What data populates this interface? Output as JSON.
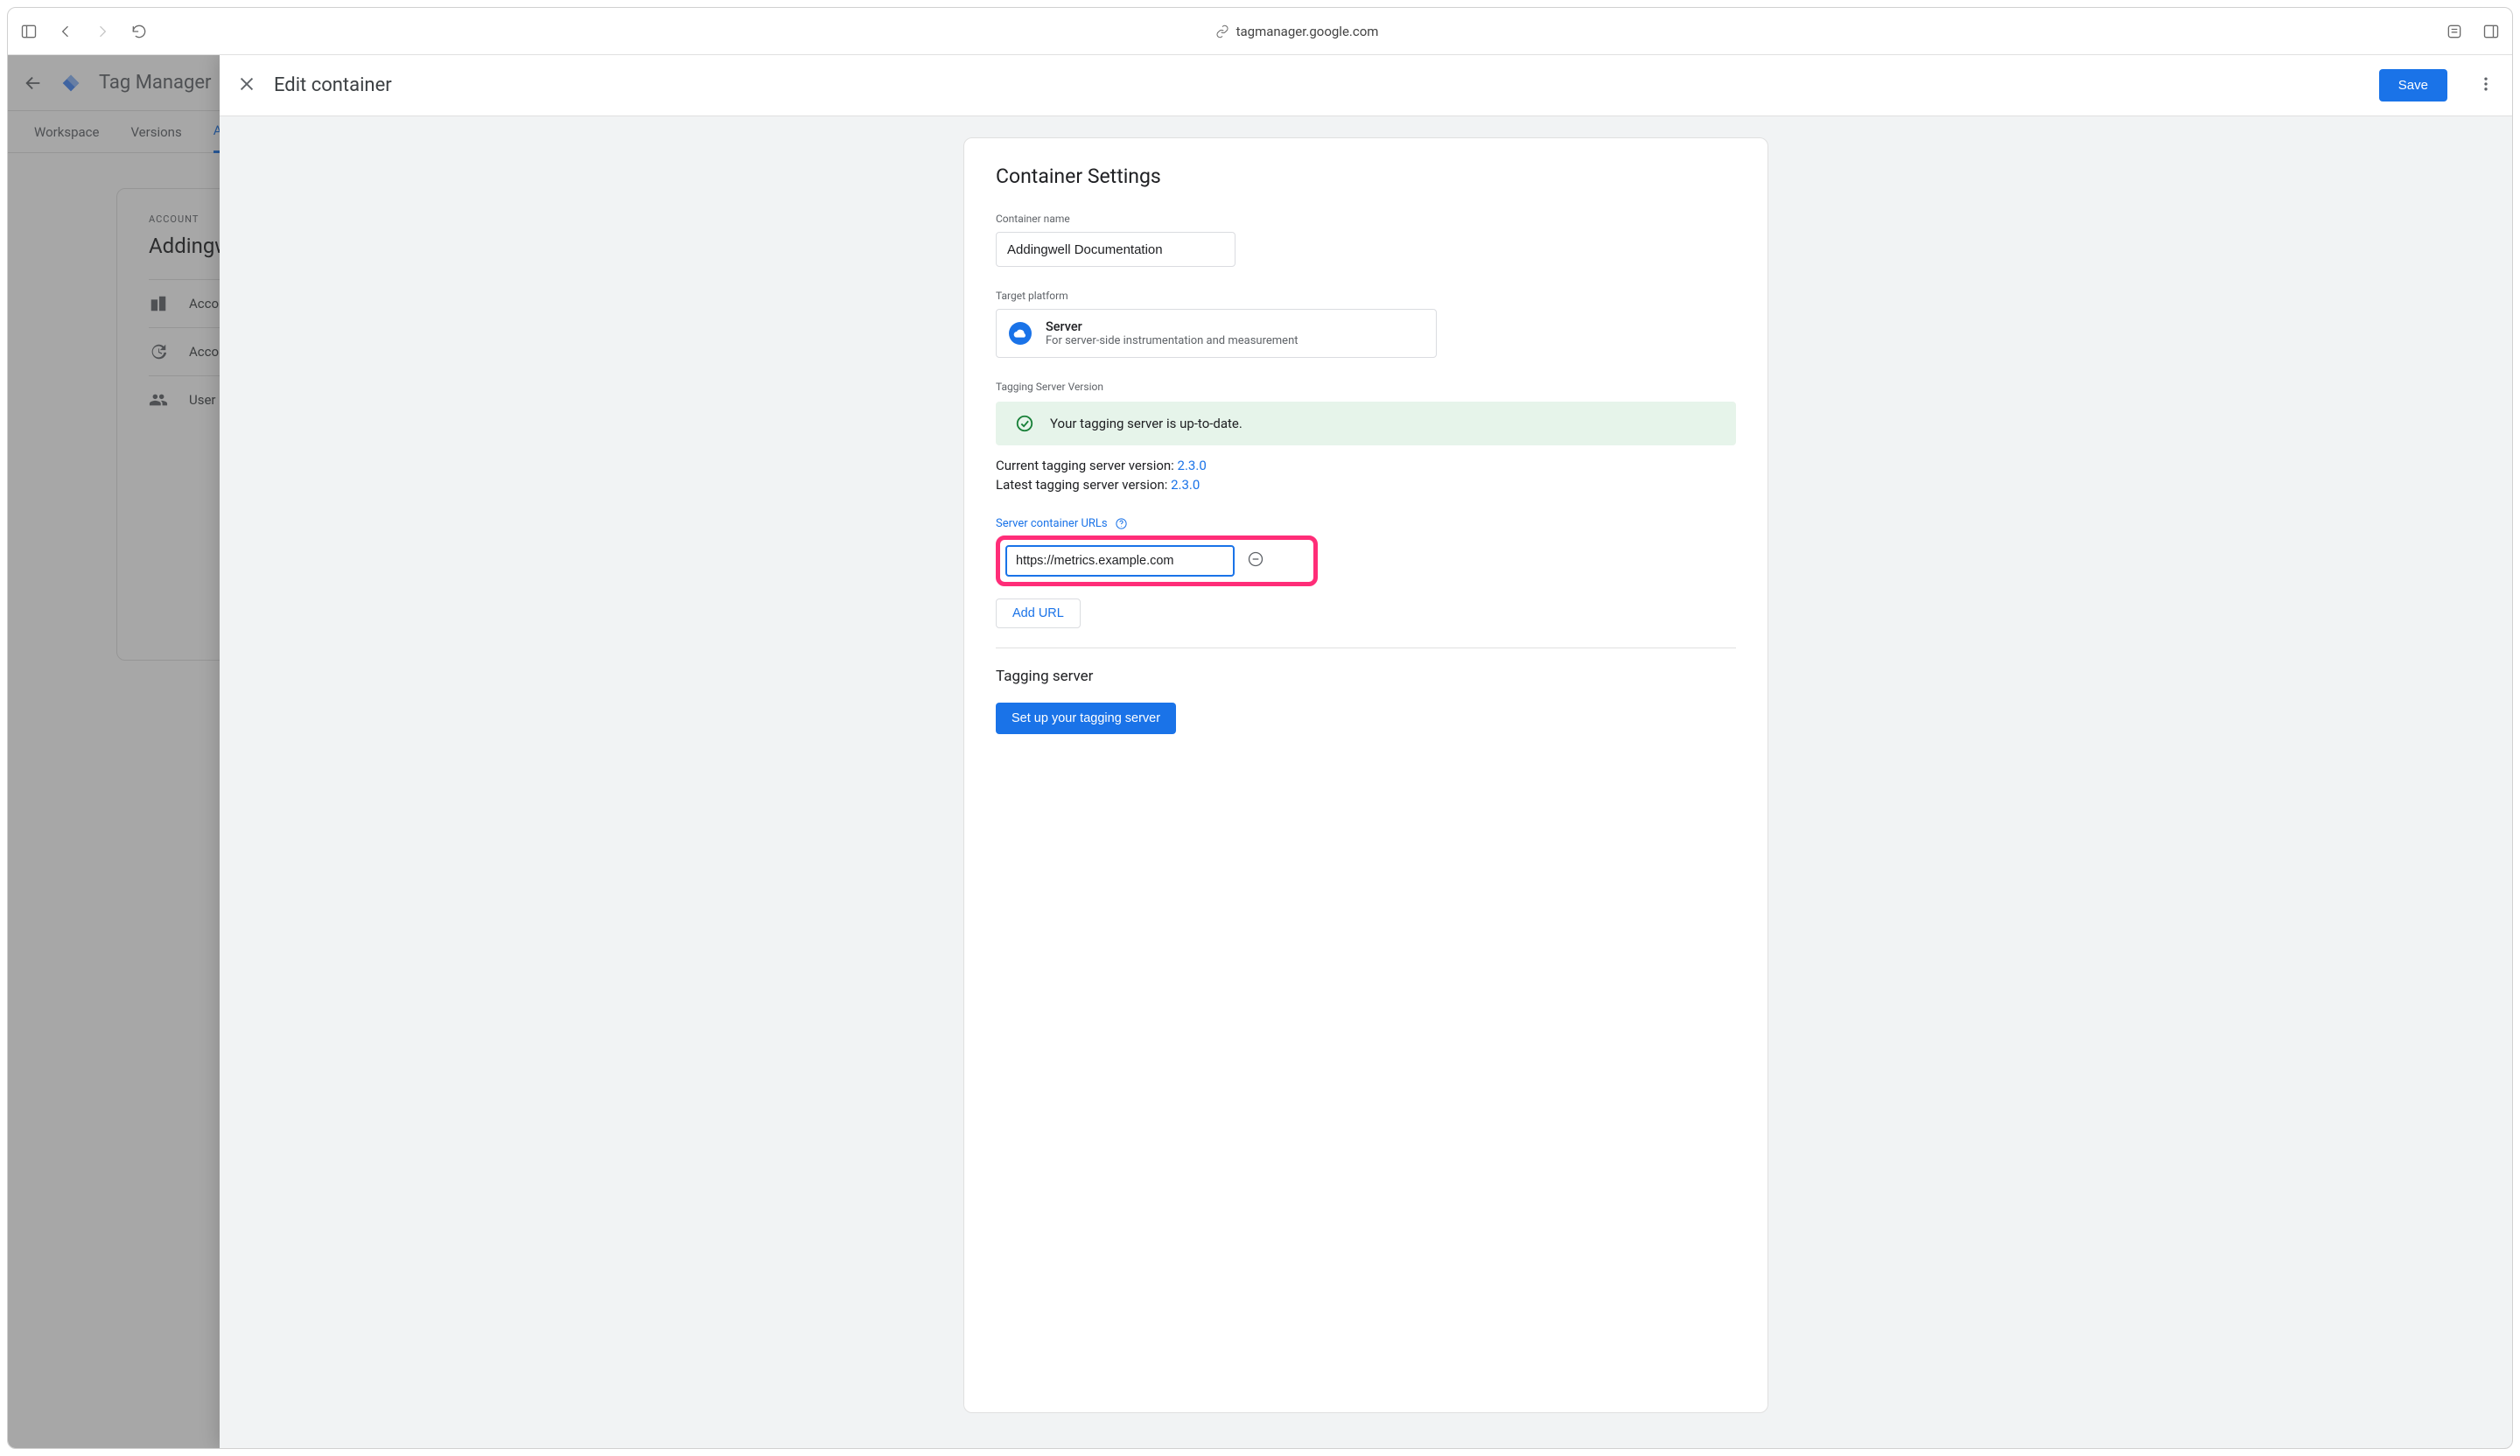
{
  "browser": {
    "url": "tagmanager.google.com"
  },
  "gtm": {
    "app_title": "Tag Manager",
    "tabs": {
      "workspace": "Workspace",
      "versions": "Versions",
      "admin_initial": "A"
    },
    "account_label": "ACCOUNT",
    "account_name": "Addingwe",
    "menu": {
      "account_settings": "Accou",
      "activity": "Accou",
      "user_mgmt": "User M"
    }
  },
  "panel": {
    "title": "Edit container",
    "save": "Save"
  },
  "settings": {
    "heading": "Container Settings",
    "container_name_label": "Container name",
    "container_name_value": "Addingwell Documentation",
    "target_platform_label": "Target platform",
    "platform_name": "Server",
    "platform_desc": "For server-side instrumentation and measurement",
    "tagging_version_label": "Tagging Server Version",
    "status_text": "Your tagging server is up-to-date.",
    "current_version_prefix": "Current tagging server version: ",
    "latest_version_prefix": "Latest tagging server version: ",
    "version": "2.3.0",
    "urls_label": "Server container URLs",
    "url_value": "https://metrics.example.com",
    "add_url": "Add URL",
    "tagging_server_heading": "Tagging server",
    "setup_btn": "Set up your tagging server"
  }
}
